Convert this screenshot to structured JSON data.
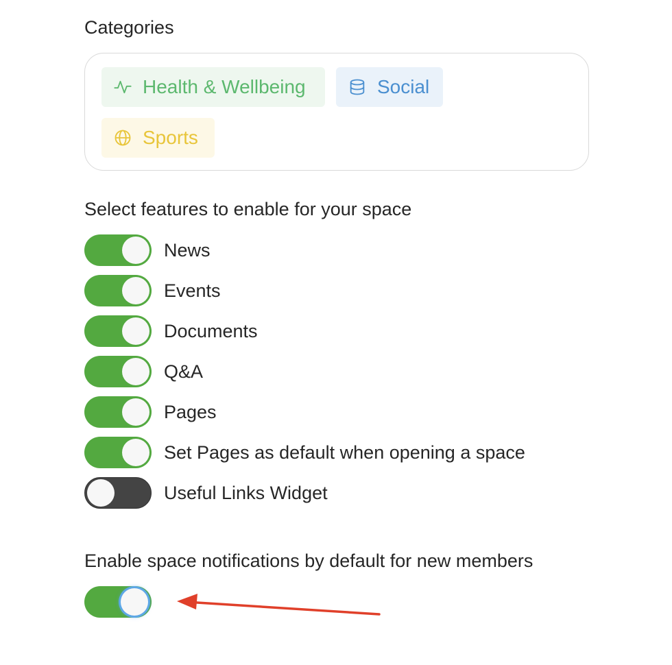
{
  "categories": {
    "title": "Categories",
    "chips": [
      {
        "label": "Health & Wellbeing",
        "icon": "activity-icon",
        "color": "#5cb86e",
        "bg": "#eef7ef"
      },
      {
        "label": "Social",
        "icon": "database-icon",
        "color": "#4a8fd0",
        "bg": "#eaf2fa"
      },
      {
        "label": "Sports",
        "icon": "globe-icon",
        "color": "#e8c53a",
        "bg": "#fdf8e6"
      }
    ]
  },
  "features": {
    "title": "Select features to enable for your space",
    "toggles": [
      {
        "label": "News",
        "on": true
      },
      {
        "label": "Events",
        "on": true
      },
      {
        "label": "Documents",
        "on": true
      },
      {
        "label": "Q&A",
        "on": true
      },
      {
        "label": "Pages",
        "on": true
      },
      {
        "label": "Set Pages as default when opening a space",
        "on": true
      },
      {
        "label": "Useful Links Widget",
        "on": false
      }
    ]
  },
  "notifications": {
    "title": "Enable space notifications by default for new members",
    "on": true
  },
  "colors": {
    "toggle_on": "#53a940",
    "toggle_off": "#444444",
    "arrow": "#e0402a",
    "focus_ring": "#5da7e6"
  }
}
